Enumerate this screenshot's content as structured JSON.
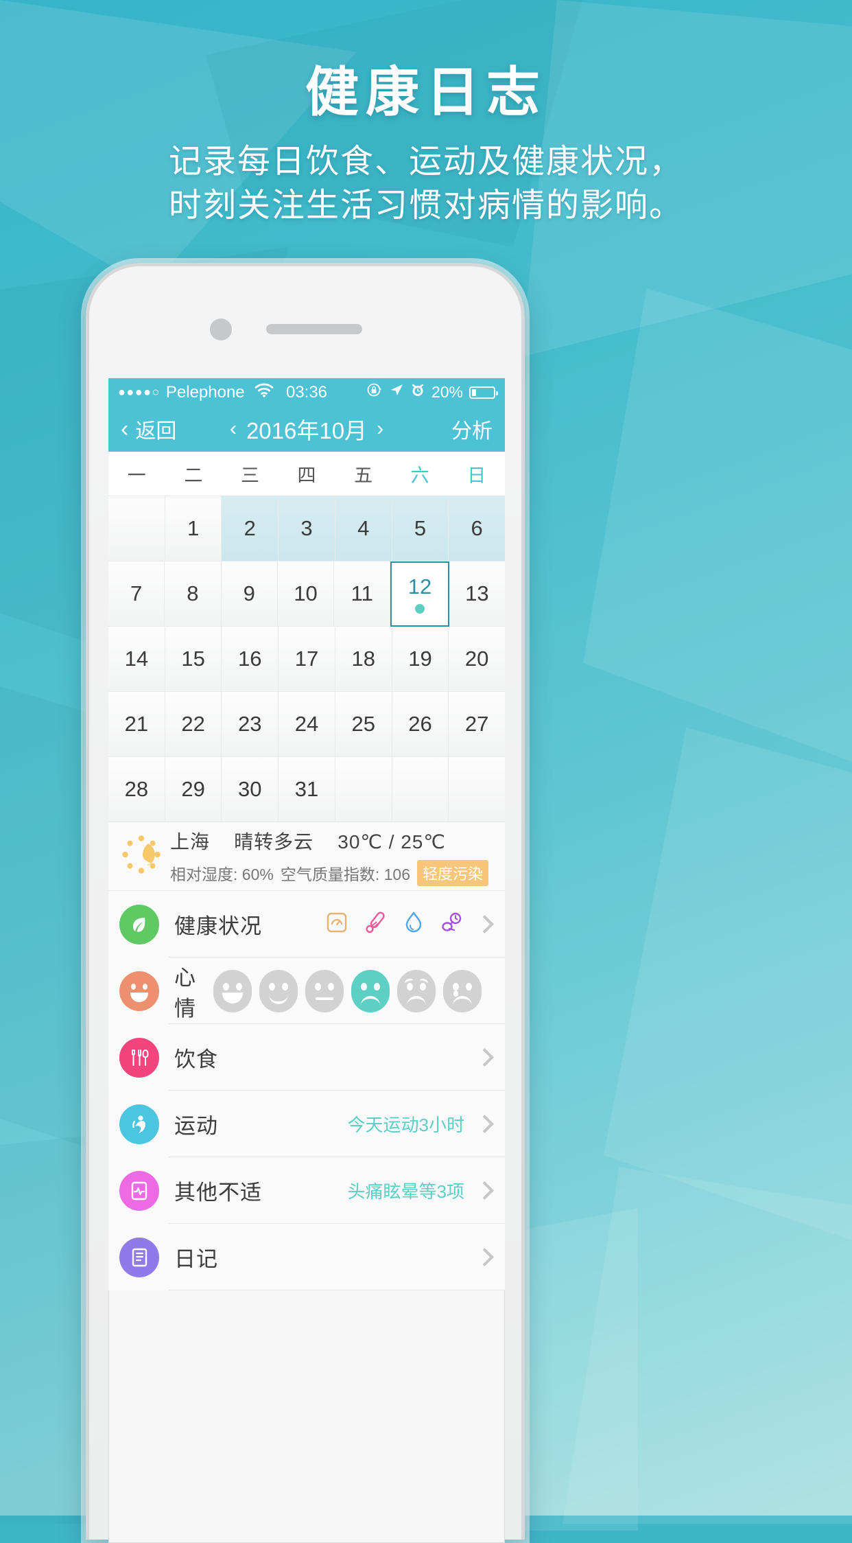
{
  "promo": {
    "title": "健康日志",
    "subtitle_line1": "记录每日饮食、运动及健康状况，",
    "subtitle_line2": "时刻关注生活习惯对病情的影响。"
  },
  "statusbar": {
    "signal_dots": "●●●●○",
    "carrier": "Pelephone",
    "wifi_icon": "wifi-icon",
    "time": "03:36",
    "rotation_lock_icon": "rotation-lock-icon",
    "location_icon": "location-arrow-icon",
    "alarm_icon": "alarm-clock-icon",
    "battery_percent": "20%",
    "battery_icon": "battery-icon"
  },
  "navbar": {
    "back_label": "返回",
    "back_icon": "chevron-left-icon",
    "prev_month_icon": "‹",
    "month_title": "2016年10月",
    "next_month_icon": "›",
    "analyze_label": "分析",
    "bg_color": "#4cc2d4"
  },
  "calendar": {
    "weekdays": [
      "一",
      "二",
      "三",
      "四",
      "五",
      "六",
      "日"
    ],
    "weekend_indices": [
      5,
      6
    ],
    "weekend_color": "#4cc2d4",
    "selected_day": "12",
    "selected_border_color": "#2d8fa2",
    "selected_dot_color": "#5ecfc5",
    "highlight_color": "#cbe7ed",
    "rows": [
      [
        {
          "d": "",
          "hl": false
        },
        {
          "d": "1",
          "hl": false
        },
        {
          "d": "2",
          "hl": true
        },
        {
          "d": "3",
          "hl": true
        },
        {
          "d": "4",
          "hl": true
        },
        {
          "d": "5",
          "hl": true
        },
        {
          "d": "6",
          "hl": true
        }
      ],
      [
        {
          "d": "7",
          "hl": false
        },
        {
          "d": "8",
          "hl": false
        },
        {
          "d": "9",
          "hl": false
        },
        {
          "d": "10",
          "hl": false
        },
        {
          "d": "11",
          "hl": false
        },
        {
          "d": "12",
          "hl": false,
          "sel": true
        },
        {
          "d": "13",
          "hl": false
        }
      ],
      [
        {
          "d": "14",
          "hl": false
        },
        {
          "d": "15",
          "hl": false
        },
        {
          "d": "16",
          "hl": false
        },
        {
          "d": "17",
          "hl": false
        },
        {
          "d": "18",
          "hl": false
        },
        {
          "d": "19",
          "hl": false
        },
        {
          "d": "20",
          "hl": false
        }
      ],
      [
        {
          "d": "21",
          "hl": false
        },
        {
          "d": "22",
          "hl": false
        },
        {
          "d": "23",
          "hl": false
        },
        {
          "d": "24",
          "hl": false
        },
        {
          "d": "25",
          "hl": false
        },
        {
          "d": "26",
          "hl": false
        },
        {
          "d": "27",
          "hl": false
        }
      ],
      [
        {
          "d": "28",
          "hl": false
        },
        {
          "d": "29",
          "hl": false
        },
        {
          "d": "30",
          "hl": false
        },
        {
          "d": "31",
          "hl": false
        },
        {
          "d": "",
          "hl": false
        },
        {
          "d": "",
          "hl": false
        },
        {
          "d": "",
          "hl": false
        }
      ]
    ]
  },
  "weather": {
    "icon": "sun-moon-icon",
    "city": "上海",
    "condition": "晴转多云",
    "temperature": "30℃ / 25℃",
    "humidity": "相对湿度: 60%",
    "aqi": "空气质量指数: 106",
    "aqi_badge": "轻度污染",
    "aqi_badge_color": "#f7c67a"
  },
  "rows": [
    {
      "name": "health-status",
      "icon": "leaf-icon",
      "icon_color": "#5fc963",
      "label": "健康状况",
      "value": "",
      "metric_icons": [
        {
          "name": "weight-scale-icon",
          "color": "#e8b273"
        },
        {
          "name": "thermometer-icon",
          "color": "#f4589b"
        },
        {
          "name": "water-drop-icon",
          "color": "#4fa6e8"
        },
        {
          "name": "blood-pressure-icon",
          "color": "#a34fe0"
        }
      ]
    },
    {
      "name": "mood",
      "icon": "smiley-face-icon",
      "icon_color": "#ed9070",
      "label": "心情",
      "value": "",
      "faces": [
        "grin",
        "smile",
        "neutral",
        "frown",
        "worried",
        "cry"
      ],
      "selected_face_index": 3,
      "selected_face_color": "#5ecfc5"
    },
    {
      "name": "diet",
      "icon": "cutlery-icon",
      "icon_color": "#f4447e",
      "label": "饮食",
      "value": ""
    },
    {
      "name": "exercise",
      "icon": "running-person-icon",
      "icon_color": "#4cc6e0",
      "label": "运动",
      "value": "今天运动3小时"
    },
    {
      "name": "other-discomfort",
      "icon": "heart-monitor-icon",
      "icon_color": "#ee6ae4",
      "label": "其他不适",
      "value": "头痛眩晕等3项"
    },
    {
      "name": "diary",
      "icon": "notebook-icon",
      "icon_color": "#8e7ae8",
      "label": "日记",
      "value": ""
    }
  ],
  "theme": {
    "accent": "#4cc2d4",
    "value_text": "#5ecfc5",
    "chevron": "#c6c6c6"
  }
}
